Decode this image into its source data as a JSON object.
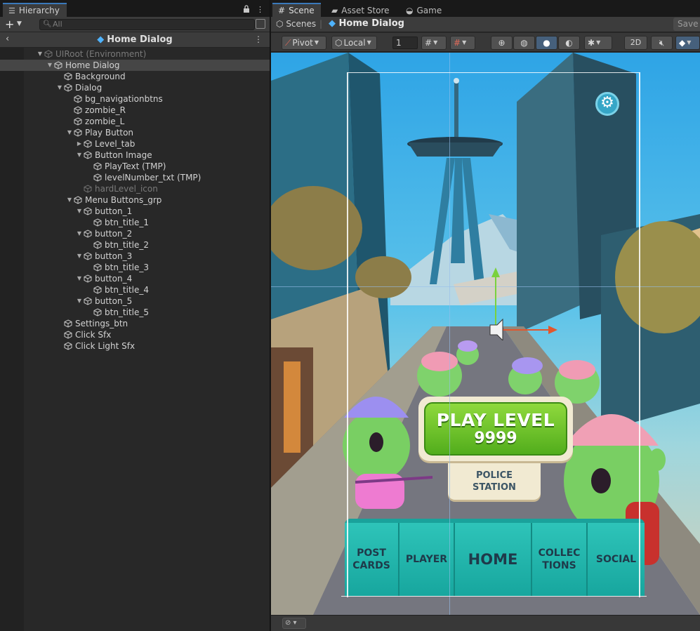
{
  "hierarchy": {
    "tab_label": "Hierarchy",
    "search_placeholder": "All",
    "scene_title": "Home Dialog",
    "items": [
      {
        "label": "UIRoot (Environment)",
        "depth": 0,
        "arrow": "down",
        "dim": true
      },
      {
        "label": "Home Dialog",
        "depth": 1,
        "arrow": "down",
        "selected": true
      },
      {
        "label": "Background",
        "depth": 2,
        "arrow": ""
      },
      {
        "label": "Dialog",
        "depth": 2,
        "arrow": "down"
      },
      {
        "label": "bg_navigationbtns",
        "depth": 3,
        "arrow": ""
      },
      {
        "label": "zombie_R",
        "depth": 3,
        "arrow": ""
      },
      {
        "label": "zombie_L",
        "depth": 3,
        "arrow": ""
      },
      {
        "label": "Play Button",
        "depth": 3,
        "arrow": "down"
      },
      {
        "label": "Level_tab",
        "depth": 4,
        "arrow": "right"
      },
      {
        "label": "Button Image",
        "depth": 4,
        "arrow": "down"
      },
      {
        "label": "PlayText (TMP)",
        "depth": 5,
        "arrow": ""
      },
      {
        "label": "levelNumber_txt (TMP)",
        "depth": 5,
        "arrow": ""
      },
      {
        "label": "hardLevel_icon",
        "depth": 4,
        "arrow": "",
        "dim": true
      },
      {
        "label": "Menu Buttons_grp",
        "depth": 3,
        "arrow": "down"
      },
      {
        "label": "button_1",
        "depth": 4,
        "arrow": "down"
      },
      {
        "label": "btn_title_1",
        "depth": 5,
        "arrow": ""
      },
      {
        "label": "button_2",
        "depth": 4,
        "arrow": "down"
      },
      {
        "label": "btn_title_2",
        "depth": 5,
        "arrow": ""
      },
      {
        "label": "button_3",
        "depth": 4,
        "arrow": "down"
      },
      {
        "label": "btn_title_3",
        "depth": 5,
        "arrow": ""
      },
      {
        "label": "button_4",
        "depth": 4,
        "arrow": "down"
      },
      {
        "label": "btn_title_4",
        "depth": 5,
        "arrow": ""
      },
      {
        "label": "button_5",
        "depth": 4,
        "arrow": "down"
      },
      {
        "label": "btn_title_5",
        "depth": 5,
        "arrow": ""
      },
      {
        "label": "Settings_btn",
        "depth": 2,
        "arrow": ""
      },
      {
        "label": "Click Sfx",
        "depth": 2,
        "arrow": ""
      },
      {
        "label": "Click Light Sfx",
        "depth": 2,
        "arrow": ""
      }
    ]
  },
  "scene_panel": {
    "tabs": [
      {
        "label": "Scene",
        "icon": "grid-icon",
        "active": true
      },
      {
        "label": "Asset Store",
        "icon": "bag-icon",
        "active": false
      },
      {
        "label": "Game",
        "icon": "gamepad-icon",
        "active": false
      }
    ],
    "breadcrumb": {
      "root": "Scenes",
      "current": "Home Dialog",
      "save": "Save"
    },
    "toolbar": {
      "pivot": "Pivot",
      "local": "Local",
      "grid_size": "1",
      "mode_2d": "2D"
    }
  },
  "game_view": {
    "play_label": "PLAY LEVEL",
    "level_number": "9999",
    "level_tab_line1": "POLICE",
    "level_tab_line2": "STATION",
    "menu": [
      {
        "line1": "POST",
        "line2": "CARDS"
      },
      {
        "line1": "PLAYER",
        "line2": ""
      },
      {
        "line1": "HOME",
        "line2": ""
      },
      {
        "line1": "COLLEC",
        "line2": "TIONS"
      },
      {
        "line1": "SOCIAL",
        "line2": ""
      }
    ]
  },
  "colors": {
    "selection": "#464646",
    "accent_blue": "#3a79bb",
    "play_green": "#6cc62a",
    "menu_teal": "#1aa29b"
  }
}
